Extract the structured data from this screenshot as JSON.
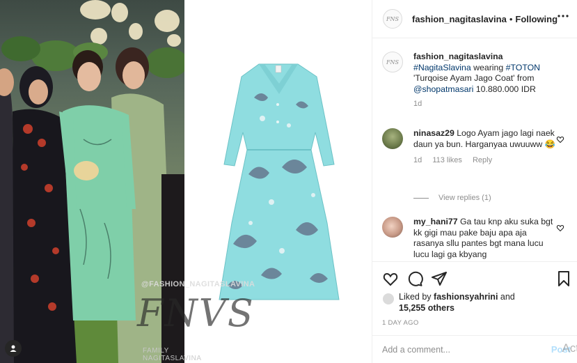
{
  "post": {
    "watermark_top": "@FASHION_NAGITASLAVINA",
    "watermark_logo": "FNVS",
    "watermark_bottom": "FAMILY NAGITASLAVINA"
  },
  "header": {
    "avatar_text": "FNS",
    "username": "fashion_nagitaslavina",
    "separator": "•",
    "follow_status": "Following"
  },
  "caption": {
    "avatar_text": "FNS",
    "username": "fashion_nagitaslavina",
    "hashtag1": "#NagitaSlavina",
    "text1": " wearing ",
    "hashtag2": "#TOTON",
    "text2": " 'Turqoise Ayam Jago Coat' from ",
    "mention": "@shopatmasari",
    "text3": " 10.880.000 IDR",
    "time": "1d"
  },
  "comments": [
    {
      "username": "ninasaz29",
      "text": " Logo Ayam jago lagi naek daun ya bun. Harganyaa uwuuww 😂",
      "time": "1d",
      "likes": "113 likes",
      "reply": "Reply"
    },
    {
      "username": "my_hani77",
      "text": " Ga tau knp aku suka bgt kk gigi mau pake baju apa aja rasanya sllu pantes bgt mana lucu lucu lagi ga kbyang"
    }
  ],
  "view_replies": "View replies (1)",
  "likes": {
    "prefix": "Liked by ",
    "user": "fashionsyahrini",
    "middle": " and",
    "count": "15,255 others"
  },
  "time_ago": "1 DAY AGO",
  "add_comment": {
    "placeholder": "Add a comment...",
    "post_label": "Post",
    "overlay": "Act"
  },
  "icons": {
    "like": "heart-icon",
    "comment": "comment-icon",
    "share": "share-icon",
    "save": "bookmark-icon",
    "more": "more-icon"
  }
}
